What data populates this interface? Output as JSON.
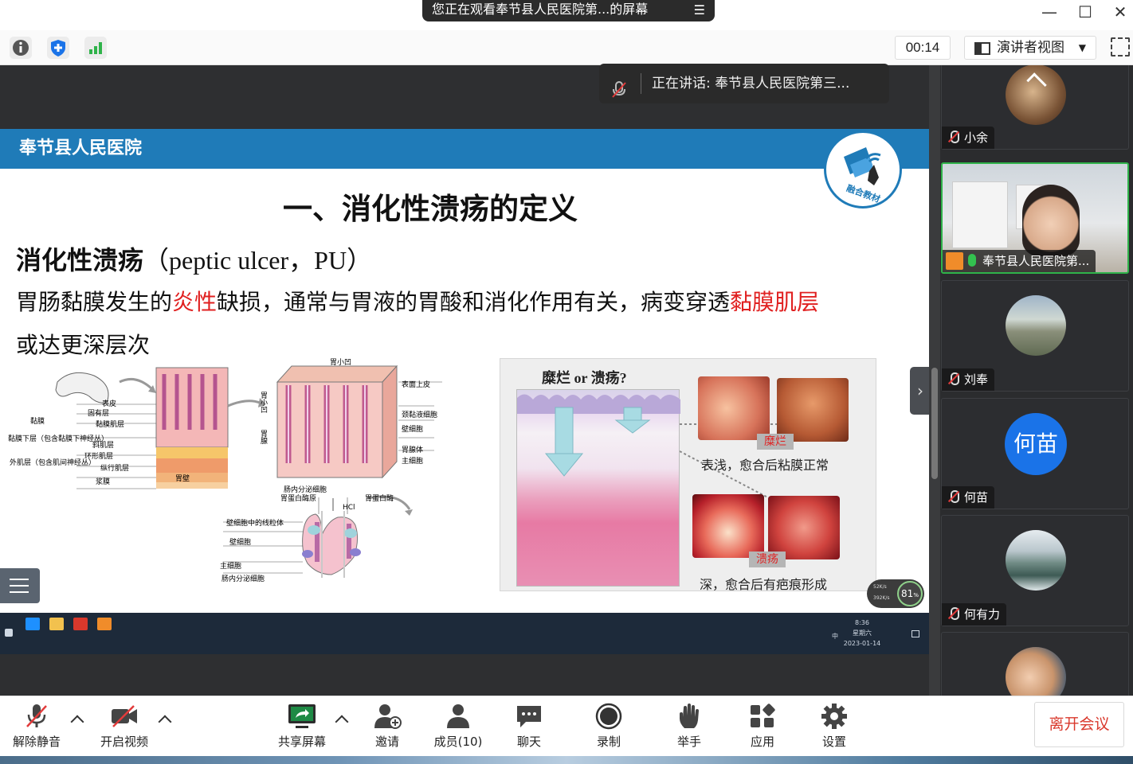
{
  "window": {
    "share_banner": "您正在观看奉节县人民医院第...的屏幕",
    "menu_glyph": "☰",
    "minimize_glyph": "—",
    "maximize_glyph": "☐",
    "close_glyph": "✕"
  },
  "toolbar": {
    "timer": "00:14",
    "view_mode": "演讲者视图"
  },
  "speaker": {
    "label": "正在讲话: 奉节县人民医院第三..."
  },
  "slide": {
    "hospital": "奉节县人民医院",
    "logo_text": "融合教材",
    "title": "一、消化性溃疡的定义",
    "term_cn": "消化性溃疡",
    "term_en": "（peptic ulcer，PU）",
    "def_part1": "胃肠黏膜发生的",
    "def_red1": "炎性",
    "def_part2": "缺损，通常与胃液的胃酸和消化作用有关，病变穿透",
    "def_red2": "黏膜肌层",
    "def_line2": "或达更深层次",
    "diagram_labels": {
      "l1": "表皮",
      "l2": "固有层",
      "l3": "黏膜肌层",
      "l4": "黏膜",
      "l5": "黏膜下层（包含黏膜下神经丛）",
      "l6": "斜肌层",
      "l7": "外肌层（包含肌间神经丛）",
      "l8": "环形肌层",
      "l9": "纵行肌层",
      "l10": "浆膜",
      "l11": "胃壁",
      "m1": "胃小凹",
      "m2": "表面上皮",
      "m3": "颈黏液细胞",
      "m4": "壁细胞",
      "m5": "胃腺体",
      "m6": "主细胞",
      "m7": "肠内分泌细胞",
      "m8": "胃小凹",
      "m9": "胃腺",
      "b1": "胃蛋白酶原",
      "b2": "胃蛋白酶",
      "b3": "壁细胞中的线粒体",
      "b4": "HCl",
      "b5": "壁细胞",
      "b6": "主细胞",
      "b7": "肠内分泌细胞"
    },
    "panel_question": "糜烂 or 溃疡?",
    "tag_erosion": "糜烂",
    "tag_ulcer": "溃疡",
    "caption_erosion": "表浅，愈合后粘膜正常",
    "caption_ulcer": "深，愈合后有疤痕形成",
    "net_percent": "81",
    "net_unit": "%",
    "net_up": "52K/s",
    "net_down": "392K/s",
    "tray_time": "8:36",
    "tray_day": "星期六",
    "tray_date": "2023-01-14",
    "tray_ime": "中"
  },
  "participants": [
    {
      "name": "小余",
      "muted": true
    },
    {
      "name": "奉节县人民医院第...",
      "muted": false,
      "active": true
    },
    {
      "name": "刘奉",
      "muted": true
    },
    {
      "name": "何苗",
      "muted": true,
      "avatar_text": "何苗"
    },
    {
      "name": "何有力",
      "muted": true
    },
    {
      "name": "",
      "muted": true
    }
  ],
  "controls": {
    "unmute": "解除静音",
    "video": "开启视频",
    "share": "共享屏幕",
    "invite": "邀请",
    "members": "成员(10)",
    "chat": "聊天",
    "record": "录制",
    "raise": "举手",
    "apps": "应用",
    "settings": "设置",
    "leave": "离开会议"
  },
  "colors": {
    "slide_header": "#1f7bb8",
    "accent_red": "#e02020",
    "active_speaker": "#2fb34a",
    "leave_text": "#d9382c",
    "avatar_blue": "#1a73e8"
  }
}
